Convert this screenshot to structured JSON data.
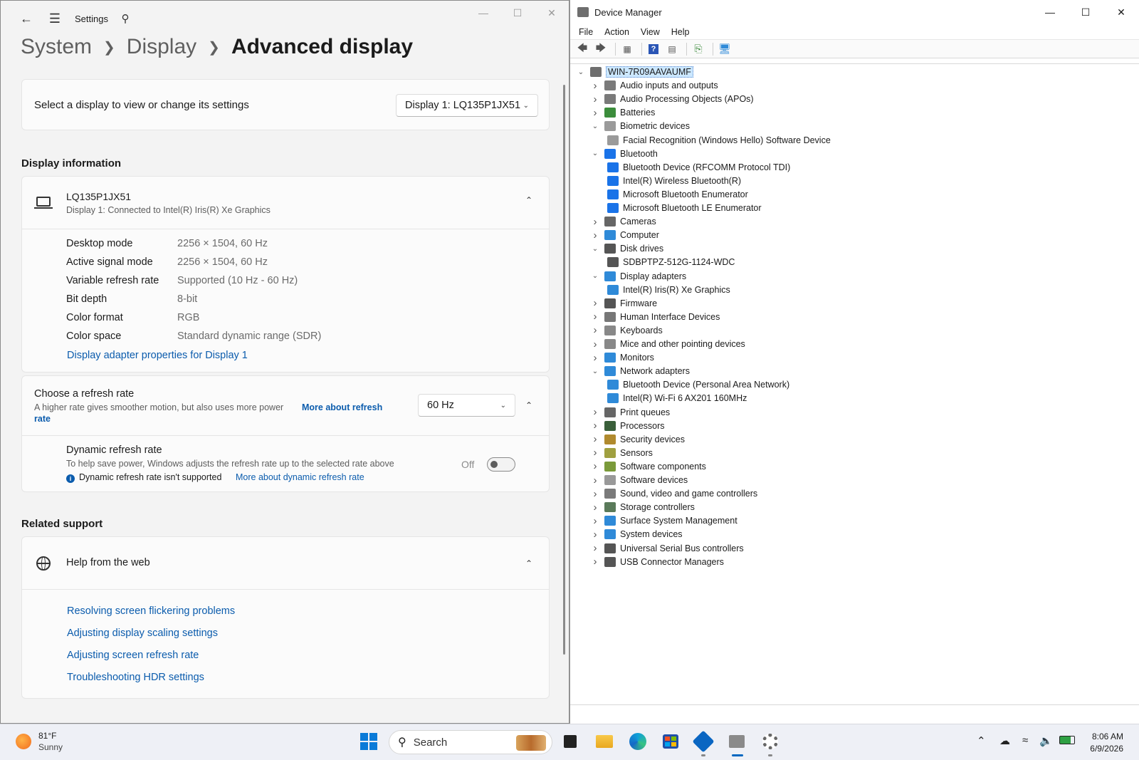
{
  "settings": {
    "app_name": "Settings",
    "breadcrumb": [
      "System",
      "Display",
      "Advanced display"
    ],
    "select_display": {
      "label": "Select a display to view or change its settings",
      "value": "Display 1: LQ135P1JX51"
    },
    "display_information": {
      "title": "Display information",
      "monitor_name": "LQ135P1JX51",
      "monitor_sub": "Display 1: Connected to Intel(R) Iris(R) Xe Graphics",
      "rows": [
        {
          "label": "Desktop mode",
          "value": "2256 × 1504, 60 Hz"
        },
        {
          "label": "Active signal mode",
          "value": "2256 × 1504, 60 Hz"
        },
        {
          "label": "Variable refresh rate",
          "value": "Supported (10 Hz - 60 Hz)"
        },
        {
          "label": "Bit depth",
          "value": "8-bit"
        },
        {
          "label": "Color format",
          "value": "RGB"
        },
        {
          "label": "Color space",
          "value": "Standard dynamic range (SDR)"
        }
      ],
      "adapter_link": "Display adapter properties for Display 1"
    },
    "refresh": {
      "title": "Choose a refresh rate",
      "desc": "A higher rate gives smoother motion, but also uses more power",
      "link_part1": "More about refresh",
      "link_part2": "rate",
      "value": "60 Hz"
    },
    "dynamic": {
      "title": "Dynamic refresh rate",
      "desc": "To help save power, Windows adjusts the refresh rate up to the selected rate above",
      "note": "Dynamic refresh rate isn't supported",
      "note_link": "More about dynamic refresh rate",
      "toggle_state": "Off"
    },
    "related": {
      "title": "Related support",
      "help_title": "Help from the web",
      "links": [
        "Resolving screen flickering problems",
        "Adjusting display scaling settings",
        "Adjusting screen refresh rate",
        "Troubleshooting HDR settings"
      ]
    }
  },
  "devmgr": {
    "title": "Device Manager",
    "menu": [
      "File",
      "Action",
      "View",
      "Help"
    ],
    "root": "WIN-7R09AAVAUMF",
    "nodes": [
      {
        "label": "Audio inputs and outputs",
        "level": 1,
        "state": "collapsed",
        "icon_color": "#7a7a7a"
      },
      {
        "label": "Audio Processing Objects (APOs)",
        "level": 1,
        "state": "collapsed",
        "icon_color": "#7a7a7a"
      },
      {
        "label": "Batteries",
        "level": 1,
        "state": "collapsed",
        "icon_color": "#3c8d3c"
      },
      {
        "label": "Biometric devices",
        "level": 1,
        "state": "expanded",
        "icon_color": "#9a9a9a"
      },
      {
        "label": "Facial Recognition (Windows Hello) Software Device",
        "level": 2,
        "state": "leaf",
        "icon_color": "#9a9a9a"
      },
      {
        "label": "Bluetooth",
        "level": 1,
        "state": "expanded",
        "icon_color": "#1a73e8"
      },
      {
        "label": "Bluetooth Device (RFCOMM Protocol TDI)",
        "level": 2,
        "state": "leaf",
        "icon_color": "#1a73e8"
      },
      {
        "label": "Intel(R) Wireless Bluetooth(R)",
        "level": 2,
        "state": "leaf",
        "icon_color": "#1a73e8"
      },
      {
        "label": "Microsoft Bluetooth Enumerator",
        "level": 2,
        "state": "leaf",
        "icon_color": "#1a73e8"
      },
      {
        "label": "Microsoft Bluetooth LE Enumerator",
        "level": 2,
        "state": "leaf",
        "icon_color": "#1a73e8"
      },
      {
        "label": "Cameras",
        "level": 1,
        "state": "collapsed",
        "icon_color": "#666666"
      },
      {
        "label": "Computer",
        "level": 1,
        "state": "collapsed",
        "icon_color": "#2f8ad8"
      },
      {
        "label": "Disk drives",
        "level": 1,
        "state": "expanded",
        "icon_color": "#555555"
      },
      {
        "label": "SDBPTPZ-512G-1124-WDC",
        "level": 2,
        "state": "leaf",
        "icon_color": "#555555"
      },
      {
        "label": "Display adapters",
        "level": 1,
        "state": "expanded",
        "icon_color": "#2f8ad8"
      },
      {
        "label": "Intel(R) Iris(R) Xe Graphics",
        "level": 2,
        "state": "leaf",
        "icon_color": "#2f8ad8"
      },
      {
        "label": "Firmware",
        "level": 1,
        "state": "collapsed",
        "icon_color": "#555555"
      },
      {
        "label": "Human Interface Devices",
        "level": 1,
        "state": "collapsed",
        "icon_color": "#777777"
      },
      {
        "label": "Keyboards",
        "level": 1,
        "state": "collapsed",
        "icon_color": "#888888"
      },
      {
        "label": "Mice and other pointing devices",
        "level": 1,
        "state": "collapsed",
        "icon_color": "#888888"
      },
      {
        "label": "Monitors",
        "level": 1,
        "state": "collapsed",
        "icon_color": "#2f8ad8"
      },
      {
        "label": "Network adapters",
        "level": 1,
        "state": "expanded",
        "icon_color": "#2f8ad8"
      },
      {
        "label": "Bluetooth Device (Personal Area Network)",
        "level": 2,
        "state": "leaf",
        "icon_color": "#2f8ad8"
      },
      {
        "label": "Intel(R) Wi-Fi 6 AX201 160MHz",
        "level": 2,
        "state": "leaf",
        "icon_color": "#2f8ad8"
      },
      {
        "label": "Print queues",
        "level": 1,
        "state": "collapsed",
        "icon_color": "#666666"
      },
      {
        "label": "Processors",
        "level": 1,
        "state": "collapsed",
        "icon_color": "#3a5f3a"
      },
      {
        "label": "Security devices",
        "level": 1,
        "state": "collapsed",
        "icon_color": "#b08a2e"
      },
      {
        "label": "Sensors",
        "level": 1,
        "state": "collapsed",
        "icon_color": "#a0a040"
      },
      {
        "label": "Software components",
        "level": 1,
        "state": "collapsed",
        "icon_color": "#7a9a3a"
      },
      {
        "label": "Software devices",
        "level": 1,
        "state": "collapsed",
        "icon_color": "#999999"
      },
      {
        "label": "Sound, video and game controllers",
        "level": 1,
        "state": "collapsed",
        "icon_color": "#7a7a7a"
      },
      {
        "label": "Storage controllers",
        "level": 1,
        "state": "collapsed",
        "icon_color": "#5a7a5a"
      },
      {
        "label": "Surface System Management",
        "level": 1,
        "state": "collapsed",
        "icon_color": "#2f8ad8"
      },
      {
        "label": "System devices",
        "level": 1,
        "state": "collapsed",
        "icon_color": "#2f8ad8"
      },
      {
        "label": "Universal Serial Bus controllers",
        "level": 1,
        "state": "collapsed",
        "icon_color": "#555555"
      },
      {
        "label": "USB Connector Managers",
        "level": 1,
        "state": "collapsed",
        "icon_color": "#555555"
      }
    ]
  },
  "taskbar": {
    "weather_temp": "81°F",
    "weather_desc": "Sunny",
    "search_label": "Search",
    "time": "8:06 AM",
    "date": "6/9/2026"
  }
}
